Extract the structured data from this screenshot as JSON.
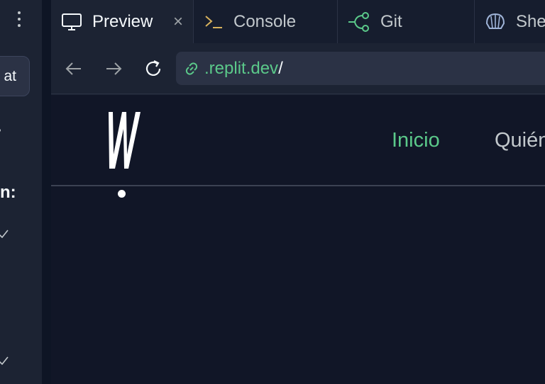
{
  "left_panel": {
    "chat_button_label": "at",
    "heading_fragment": "n:",
    "icons": [
      "more-vertical-icon",
      "check-icon"
    ]
  },
  "tabs": [
    {
      "label": "Preview",
      "icon": "monitor-icon",
      "active": true,
      "close": "×"
    },
    {
      "label": "Console",
      "icon": "terminal-icon",
      "active": false
    },
    {
      "label": "Git",
      "icon": "git-branch-icon",
      "active": false
    },
    {
      "label": "She",
      "icon": "shell-icon",
      "active": false
    }
  ],
  "address_bar": {
    "host": ".replit.dev",
    "path": "/"
  },
  "site": {
    "logo_letter": "W",
    "nav": [
      "Inicio",
      "Quién"
    ]
  },
  "colors": {
    "accent_green": "#5bc98a",
    "background": "#111627",
    "chrome": "#1c2333"
  }
}
